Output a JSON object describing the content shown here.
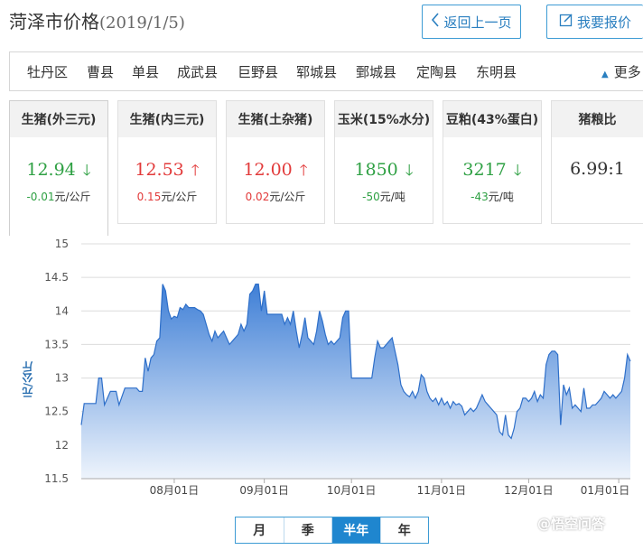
{
  "header": {
    "title": "菏泽市价格",
    "date": "(2019/1/5)",
    "back_label": "返回上一页",
    "report_label": "我要报价"
  },
  "regions": {
    "items": [
      "牡丹区",
      "曹县",
      "单县",
      "成武县",
      "巨野县",
      "郓城县",
      "鄄城县",
      "定陶县",
      "东明县"
    ],
    "more_label": "更多"
  },
  "cards": [
    {
      "title": "生猪(外三元)",
      "value": "12.94",
      "direction": "down",
      "change": "-0.01",
      "unit": "元/公斤"
    },
    {
      "title": "生猪(内三元)",
      "value": "12.53",
      "direction": "up",
      "change": "0.15",
      "unit": "元/公斤"
    },
    {
      "title": "生猪(土杂猪)",
      "value": "12.00",
      "direction": "up",
      "change": "0.02",
      "unit": "元/公斤"
    },
    {
      "title": "玉米(15%水分)",
      "value": "1850",
      "direction": "down",
      "change": "-50",
      "unit": "元/吨"
    },
    {
      "title": "豆粕(43%蛋白)",
      "value": "3217",
      "direction": "down",
      "change": "-43",
      "unit": "元/吨"
    },
    {
      "title": "猪粮比",
      "value": "6.99:1",
      "direction": "",
      "change": "",
      "unit": ""
    }
  ],
  "colors": {
    "up": "#e23a3a",
    "down": "#2ea043",
    "accent": "#1f86cf",
    "fill_top": "#3f7fd6",
    "fill_bottom": "#e8f0fb"
  },
  "chart_data": {
    "type": "area",
    "ylabel": "元/公斤",
    "ylim": [
      11.5,
      15
    ],
    "yticks": [
      "15",
      "14.5",
      "14",
      "13.5",
      "13",
      "12.5",
      "12",
      "11.5"
    ],
    "xticks": [
      {
        "label": "08月01日",
        "day": 32
      },
      {
        "label": "09月01日",
        "day": 63
      },
      {
        "label": "10月01日",
        "day": 93
      },
      {
        "label": "11月01日",
        "day": 124
      },
      {
        "label": "12月01日",
        "day": 154
      },
      {
        "label": "01月01日",
        "day": 185
      }
    ],
    "x": [
      0,
      1,
      3,
      5,
      6,
      7,
      8,
      10,
      12,
      13,
      15,
      17,
      19,
      20,
      21,
      22,
      23,
      24,
      25,
      26,
      27,
      28,
      29,
      30,
      31,
      32,
      33,
      34,
      35,
      36,
      37,
      38,
      39,
      40,
      41,
      42,
      43,
      44,
      45,
      46,
      47,
      48,
      49,
      50,
      51,
      52,
      53,
      54,
      55,
      56,
      57,
      58,
      59,
      60,
      61,
      62,
      63,
      64,
      65,
      66,
      67,
      68,
      69,
      70,
      71,
      72,
      73,
      74,
      75,
      76,
      77,
      78,
      79,
      80,
      81,
      82,
      83,
      84,
      85,
      86,
      87,
      88,
      89,
      90,
      91,
      92,
      93,
      94,
      95,
      96,
      97,
      98,
      99,
      100,
      101,
      102,
      103,
      104,
      105,
      106,
      107,
      108,
      109,
      110,
      111,
      112,
      113,
      114,
      115,
      116,
      117,
      118,
      119,
      120,
      121,
      122,
      123,
      124,
      125,
      126,
      127,
      128,
      129,
      130,
      131,
      132,
      133,
      134,
      135,
      136,
      137,
      138,
      139,
      140,
      141,
      142,
      143,
      144,
      145,
      146,
      147,
      148,
      149,
      150,
      151,
      152,
      153,
      154,
      155,
      156,
      157,
      158,
      159,
      160,
      161,
      162,
      163,
      164,
      165,
      166,
      167,
      168,
      169,
      170,
      171,
      172,
      173,
      174,
      175,
      176,
      177,
      178,
      179,
      180,
      181,
      182,
      183,
      184,
      185,
      186,
      187,
      188,
      189
    ],
    "values": [
      12.3,
      12.62,
      12.62,
      12.62,
      13.0,
      13.0,
      12.6,
      12.8,
      12.8,
      12.6,
      12.85,
      12.85,
      12.85,
      12.8,
      12.8,
      13.3,
      13.1,
      13.3,
      13.35,
      13.55,
      13.6,
      14.4,
      14.3,
      14.0,
      13.88,
      13.92,
      13.9,
      14.05,
      14.02,
      14.1,
      14.05,
      14.05,
      14.05,
      14.02,
      14.0,
      13.95,
      13.8,
      13.65,
      13.55,
      13.7,
      13.6,
      13.65,
      13.7,
      13.6,
      13.5,
      13.55,
      13.6,
      13.65,
      13.8,
      13.7,
      13.8,
      14.25,
      14.3,
      14.4,
      14.4,
      14.0,
      14.3,
      13.95,
      13.95,
      13.95,
      13.95,
      13.95,
      13.95,
      13.8,
      13.9,
      13.8,
      14.0,
      13.7,
      13.45,
      13.65,
      13.9,
      13.6,
      13.55,
      13.5,
      13.7,
      14.0,
      13.85,
      13.65,
      13.5,
      13.55,
      13.5,
      13.55,
      13.6,
      13.9,
      14.0,
      14.0,
      13.0,
      13.0,
      13.0,
      13.0,
      13.0,
      13.0,
      13.0,
      13.0,
      13.3,
      13.55,
      13.45,
      13.45,
      13.5,
      13.55,
      13.6,
      13.4,
      13.2,
      12.9,
      12.8,
      12.75,
      12.72,
      12.8,
      12.7,
      12.8,
      13.05,
      13.0,
      12.8,
      12.7,
      12.65,
      12.7,
      12.6,
      12.7,
      12.6,
      12.65,
      12.55,
      12.65,
      12.6,
      12.62,
      12.58,
      12.45,
      12.5,
      12.55,
      12.5,
      12.55,
      12.65,
      12.75,
      12.65,
      12.6,
      12.55,
      12.5,
      12.45,
      12.2,
      12.15,
      12.45,
      12.15,
      12.1,
      12.25,
      12.5,
      12.55,
      12.7,
      12.7,
      12.65,
      12.7,
      12.8,
      12.65,
      12.75,
      12.7,
      13.2,
      13.35,
      13.4,
      13.4,
      13.35,
      12.3,
      12.9,
      12.75,
      12.85,
      12.55,
      12.6,
      12.55,
      12.5,
      12.85,
      12.55,
      12.55,
      12.6,
      12.6,
      12.65,
      12.7,
      12.8,
      12.75,
      12.7,
      12.75,
      12.7,
      12.75,
      12.8,
      13.0,
      13.35,
      13.25,
      13.3,
      12.6,
      12.65,
      12.6,
      12.7,
      12.95
    ]
  },
  "period_tabs": {
    "items": [
      "月",
      "季",
      "半年",
      "年"
    ],
    "active": 2
  },
  "watermark": "@悟空问答"
}
